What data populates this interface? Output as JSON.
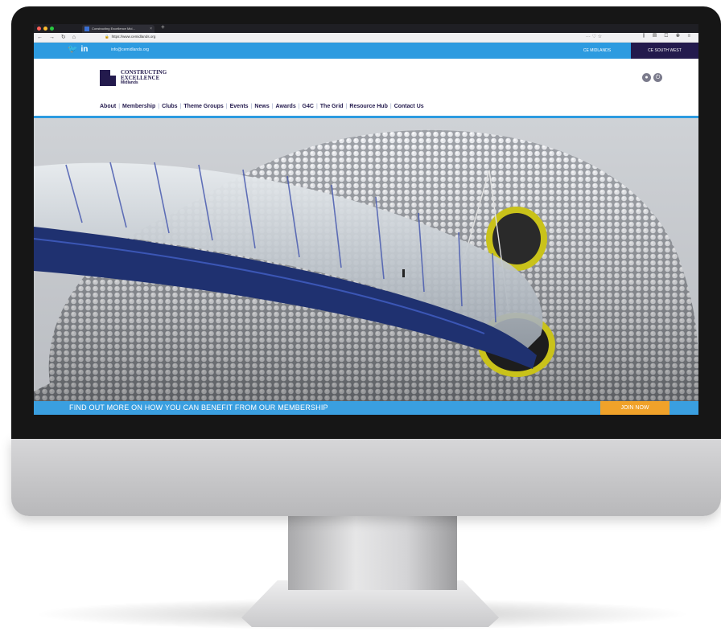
{
  "browser": {
    "tab_title": "Constructing Excellence Mid...",
    "tab_close": "×",
    "new_tab": "+",
    "url": "https://www.cemidlands.org",
    "nav_glyphs": "← → ↻ ⌂",
    "url_right_glyphs": "··· ♡ ☆",
    "toolbar_glyphs": "⫼ ▤ ◫ ◉ ≡"
  },
  "topbar": {
    "social_twitter": "🐦",
    "social_linkedin": "in",
    "email": "info@cemidlands.org",
    "region_midlands": "CE MIDLANDS",
    "region_southwest": "CE SOUTH WEST"
  },
  "header": {
    "logo_line1": "CONSTRUCTING",
    "logo_line2": "EXCELLENCE",
    "logo_line3": "Midlands",
    "icon_user": "●",
    "icon_power": "⏻"
  },
  "menu": {
    "items": [
      "About",
      "Membership",
      "Clubs",
      "Theme Groups",
      "Events",
      "News",
      "Awards",
      "G4C",
      "The Grid",
      "Resource Hub",
      "Contact Us"
    ],
    "separator": "|"
  },
  "cta": {
    "text": "FIND OUT MORE ON HOW YOU CAN BENEFIT FROM OUR MEMBERSHIP",
    "button": "JOIN NOW"
  },
  "colors": {
    "topbar_blue": "#2d9be0",
    "navy": "#231a4d",
    "cta_orange": "#f0a22a"
  }
}
